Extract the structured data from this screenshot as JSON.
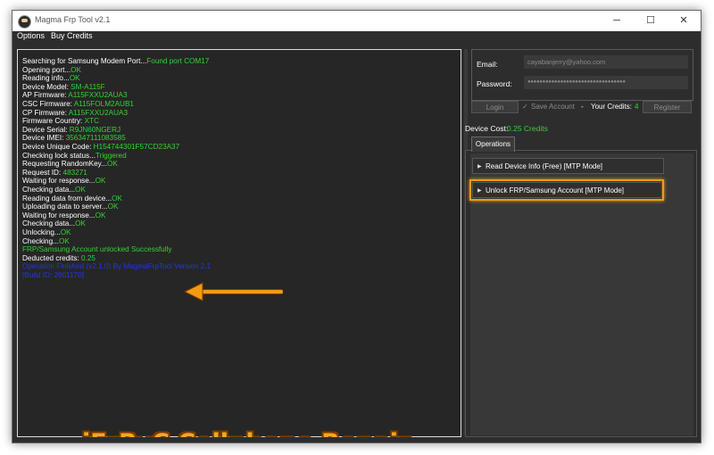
{
  "window": {
    "title": "Magma Frp Tool v2.1"
  },
  "title_buttons": {
    "minimize": "─",
    "maximize": "☐",
    "close": "✕"
  },
  "menu": {
    "options": "Options",
    "buy_credits": "Buy Credits"
  },
  "log_lines": [
    {
      "label": "Searching for Samsung Modem Port...",
      "value": "Found port COM17",
      "color": "green"
    },
    {
      "label": "Opening port...",
      "value": "OK",
      "color": "green"
    },
    {
      "label": "Reading info...",
      "value": "OK",
      "color": "green"
    },
    {
      "label": "Device Model: ",
      "value": "SM-A115F",
      "color": "green"
    },
    {
      "label": "AP Firmware: ",
      "value": "A115FXXU2AUA3",
      "color": "green"
    },
    {
      "label": "CSC Firmware: ",
      "value": "A115FOLM2AUB1",
      "color": "green"
    },
    {
      "label": "CP Firmware: ",
      "value": "A115FXXU2AUA3",
      "color": "green"
    },
    {
      "label": "Firmware Country: ",
      "value": "XTC",
      "color": "green"
    },
    {
      "label": "Device Serial: ",
      "value": "R9JN60NGERJ",
      "color": "green"
    },
    {
      "label": "Device IMEI: ",
      "value": "356347111083585",
      "color": "green"
    },
    {
      "label": "Device Unique Code: ",
      "value": "H154744301F57CD23A37",
      "color": "green"
    },
    {
      "label": "Checking lock status...",
      "value": "Triggered",
      "color": "green"
    },
    {
      "label": "Requesting RandomKey...",
      "value": "OK",
      "color": "green"
    },
    {
      "label": "Request ID: ",
      "value": "483271",
      "color": "green"
    },
    {
      "label": "Waiting for response...",
      "value": "OK",
      "color": "green"
    },
    {
      "label": "Checking data...",
      "value": "OK",
      "color": "green"
    },
    {
      "label": "Reading data from device...",
      "value": "OK",
      "color": "green"
    },
    {
      "label": "Uploading data to server...",
      "value": "OK",
      "color": "green"
    },
    {
      "label": "Waiting for response...",
      "value": "OK",
      "color": "green"
    },
    {
      "label": "Checking data...",
      "value": "OK",
      "color": "green"
    },
    {
      "label": "Unlocking...",
      "value": "OK",
      "color": "green"
    },
    {
      "label": "Checking...",
      "value": "OK",
      "color": "green"
    },
    {
      "label": "",
      "value": "FRP/Samsung Account unlocked Successfully",
      "color": "green"
    },
    {
      "label": "Deducted credits: ",
      "value": "0.25",
      "color": "green"
    },
    {
      "label": "",
      "value": "Operation Finished (v2.1.0) By MagmaFrpTool Version 2.1",
      "color": "blue"
    },
    {
      "label": "",
      "value": "[Build ID: 2601170]",
      "color": "blue"
    }
  ],
  "watermark": "jErRyC Cellphone Repair",
  "account": {
    "email_label": "Email:",
    "email_value": "cayabanjerry@yahoo.com",
    "password_label": "Password:",
    "password_value": "●●●●●●●●●●●●●●●●●●●●●●●●●●●●●●●●●",
    "login_button": "Login",
    "save_account_check": "✓",
    "save_account_label": "Save Account",
    "separator": "-",
    "your_credits_label": "Your Credits:",
    "your_credits_value": "4",
    "register_button": "Register"
  },
  "device_cost": {
    "label": "Device Cost:",
    "value": "0.25 Credits"
  },
  "tabs": {
    "operations": "Operations"
  },
  "operations": [
    {
      "label": "Read Device Info (Free) [MTP Mode]"
    },
    {
      "label": "Unlock FRP/Samsung Account [MTP Mode]"
    }
  ],
  "caret": "▶",
  "colors": {
    "green": "#34d234",
    "blue": "#2236e0",
    "highlight": "#f39a12"
  }
}
